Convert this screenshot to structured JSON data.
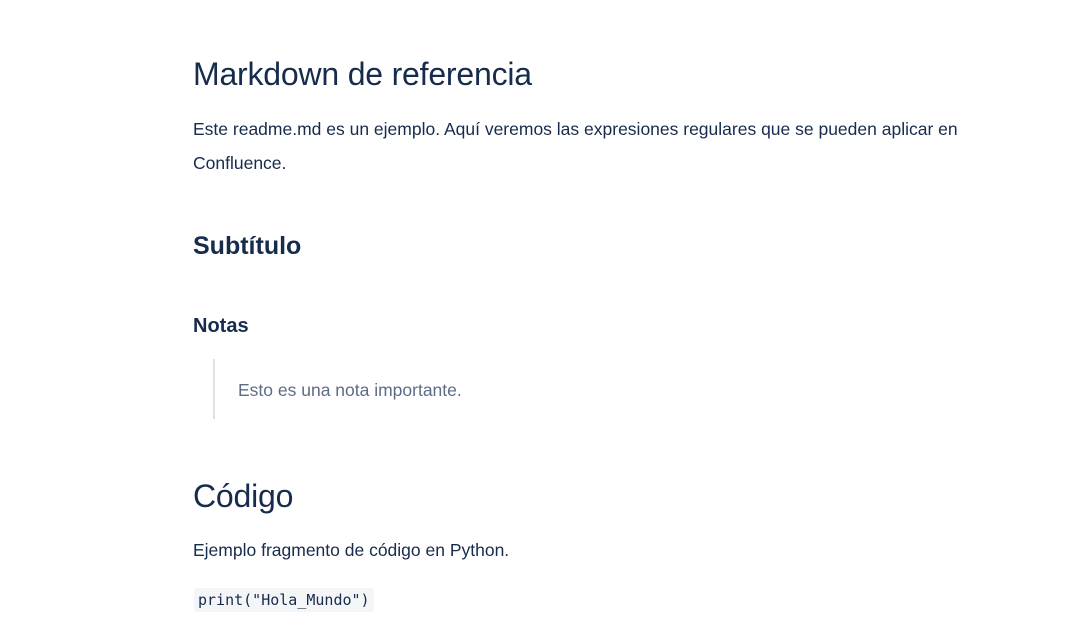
{
  "document": {
    "title": "Markdown de referencia",
    "intro": "Este readme.md es un ejemplo. Aquí veremos las expresiones regulares que se pueden aplicar en Confluence.",
    "subtitle": "Subtítulo",
    "notes_heading": "Notas",
    "note_text": "Esto es una nota importante.",
    "code_heading": "Código",
    "code_description": "Ejemplo fragmento de código en Python.",
    "code_snippet": "print(\"Hola_Mundo\")"
  }
}
